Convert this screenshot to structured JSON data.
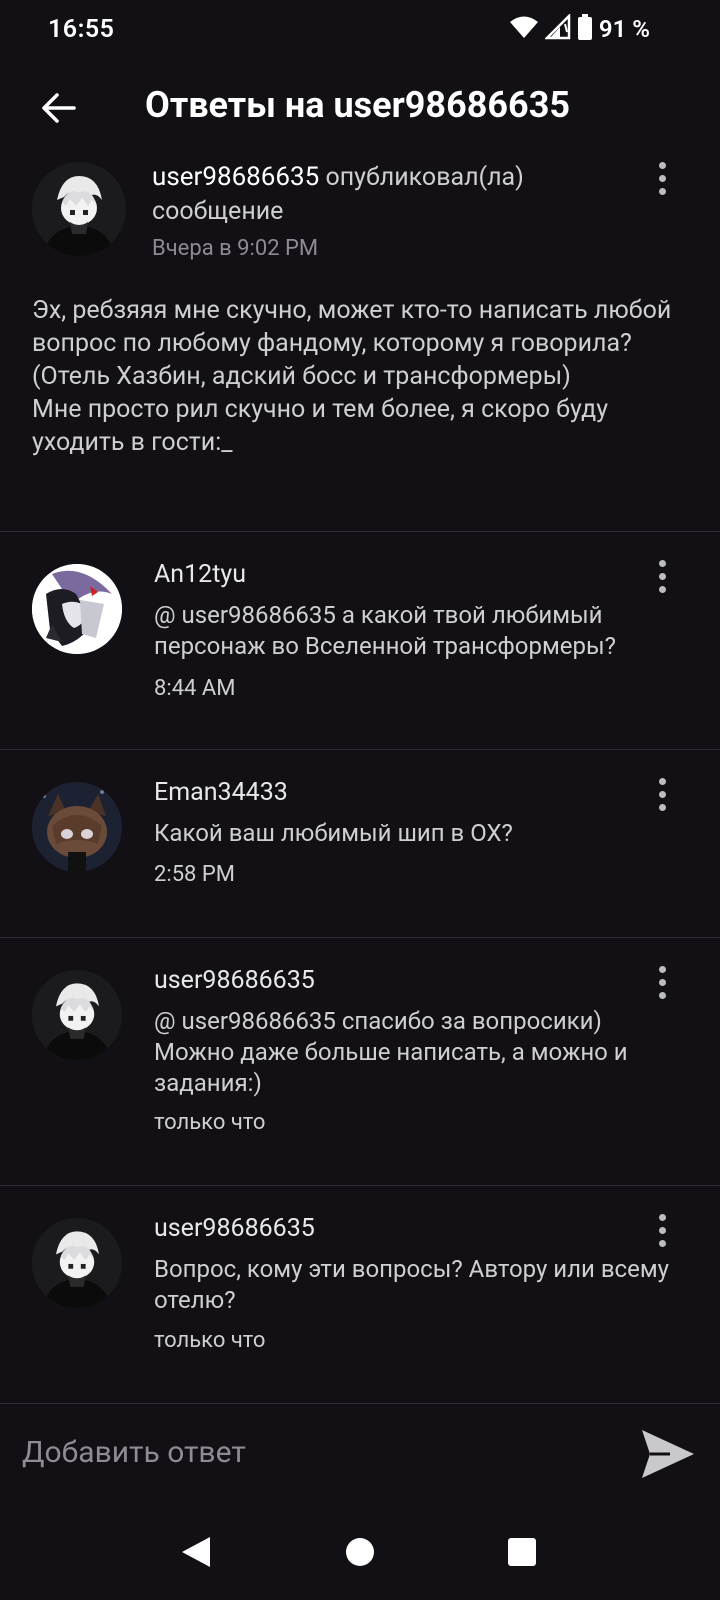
{
  "status_bar": {
    "time": "16:55",
    "battery_percent": "91 %"
  },
  "header": {
    "title": "Ответы на user98686635"
  },
  "post": {
    "author": "user98686635",
    "action": " опубликовал(ла) сообщение",
    "timestamp": "Вчера в 9:02 PM",
    "body": "Эх, ребзяяя мне скучно, может кто-то написать любой вопрос по любому фандому, которому я говорила?\n(Отель Хазбин, адский босс и трансформеры)\nМне просто рил скучно и тем более, я скоро буду уходить в гости:_"
  },
  "replies": [
    {
      "author": "An12tyu",
      "text": "@ user98686635  а какой твой любимый персонаж во Вселенной трансформеры?",
      "time": "8:44 AM"
    },
    {
      "author": "Eman34433",
      "text": "Какой ваш любимый шип в ОХ?",
      "time": "2:58 PM"
    },
    {
      "author": "user98686635",
      "text": "@ user98686635  спасибо за вопросики)\nМожно даже больше написать, а можно и задания:)",
      "time": "только что"
    },
    {
      "author": "user98686635",
      "text": "Вопрос, кому эти вопросы? Автору или всему отелю?",
      "time": "только что"
    }
  ],
  "reply_bar": {
    "placeholder": "Добавить ответ"
  },
  "icons": {
    "status": [
      "wifi-icon",
      "signal-icon",
      "battery-icon"
    ],
    "header": [
      "back-arrow-icon"
    ],
    "actions": [
      "more-vert-icon",
      "send-icon"
    ],
    "nav": [
      "nav-back-icon",
      "nav-home-icon",
      "nav-recents-icon"
    ]
  }
}
